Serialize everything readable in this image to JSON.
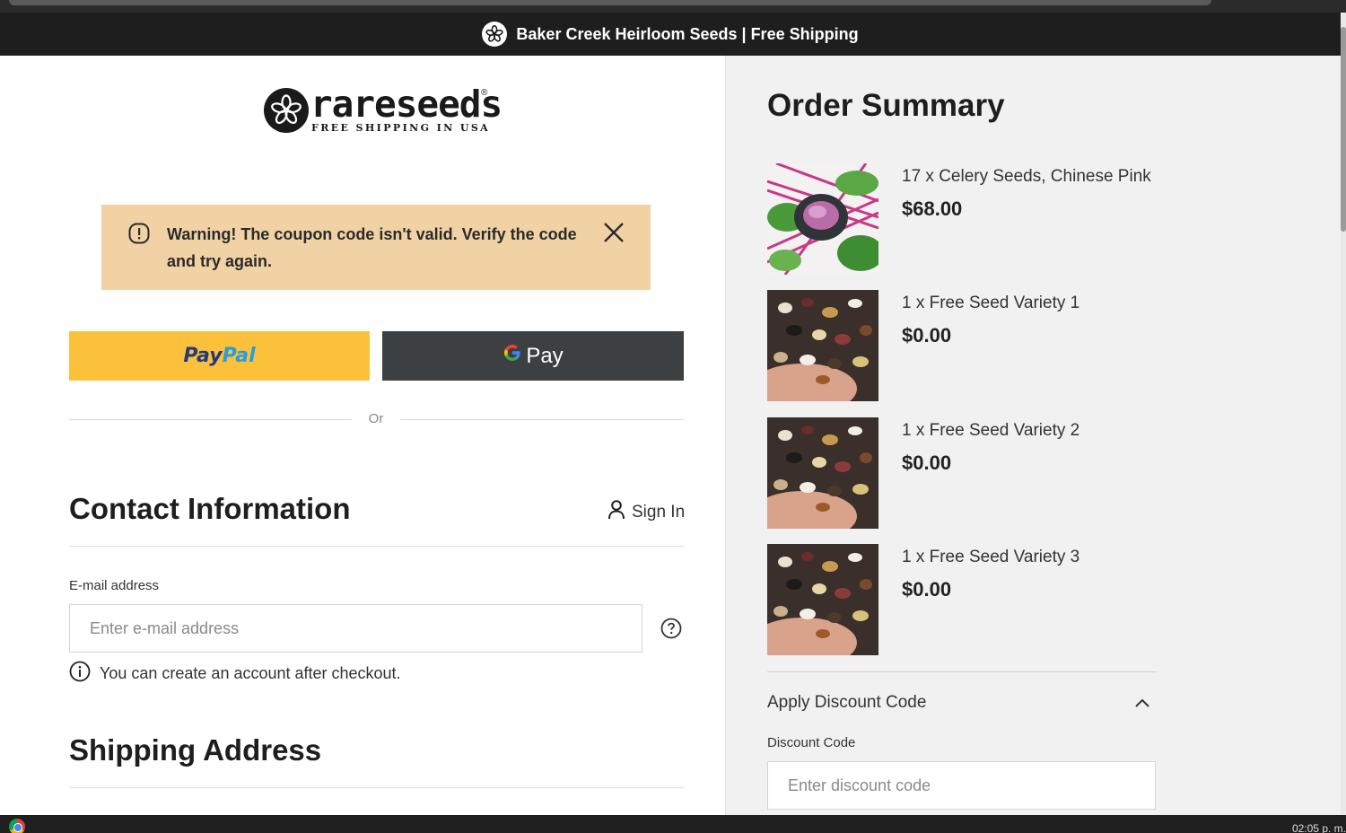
{
  "promo_bar": {
    "text": "Baker Creek Heirloom Seeds | Free Shipping",
    "logo_icon": "flower-logo-icon"
  },
  "brand": {
    "wordmark": "rareseeds",
    "registered": "®",
    "tagline": "FREE SHIPPING IN USA"
  },
  "warning": {
    "message": "Warning! The coupon code isn't valid. Verify the code and try again.",
    "bg_color": "#f1d2a5"
  },
  "express_checkout": {
    "paypal": {
      "label_part1": "Pay",
      "label_part2": "Pal",
      "bg_color": "#fcc13a"
    },
    "gpay": {
      "g_label": "G",
      "label": "Pay",
      "bg_color": "#3c4043"
    },
    "divider_text": "Or"
  },
  "contact": {
    "title": "Contact Information",
    "sign_in": "Sign In",
    "email_label": "E-mail address",
    "email_placeholder": "Enter e-mail address",
    "email_value": "",
    "hint": "You can create an account after checkout."
  },
  "shipping": {
    "title": "Shipping Address"
  },
  "order_summary": {
    "title": "Order Summary",
    "items": [
      {
        "name": "17 x Celery Seeds, Chinese Pink",
        "price": "$68.00"
      },
      {
        "name": "1 x Free Seed Variety 1",
        "price": "$0.00"
      },
      {
        "name": "1 x Free Seed Variety 2",
        "price": "$0.00"
      },
      {
        "name": "1 x Free Seed Variety 3",
        "price": "$0.00"
      }
    ],
    "discount": {
      "toggle_label": "Apply Discount Code",
      "field_label": "Discount Code",
      "placeholder": "Enter discount code",
      "value": ""
    }
  },
  "taskbar": {
    "clock": "02:05 p. m."
  }
}
